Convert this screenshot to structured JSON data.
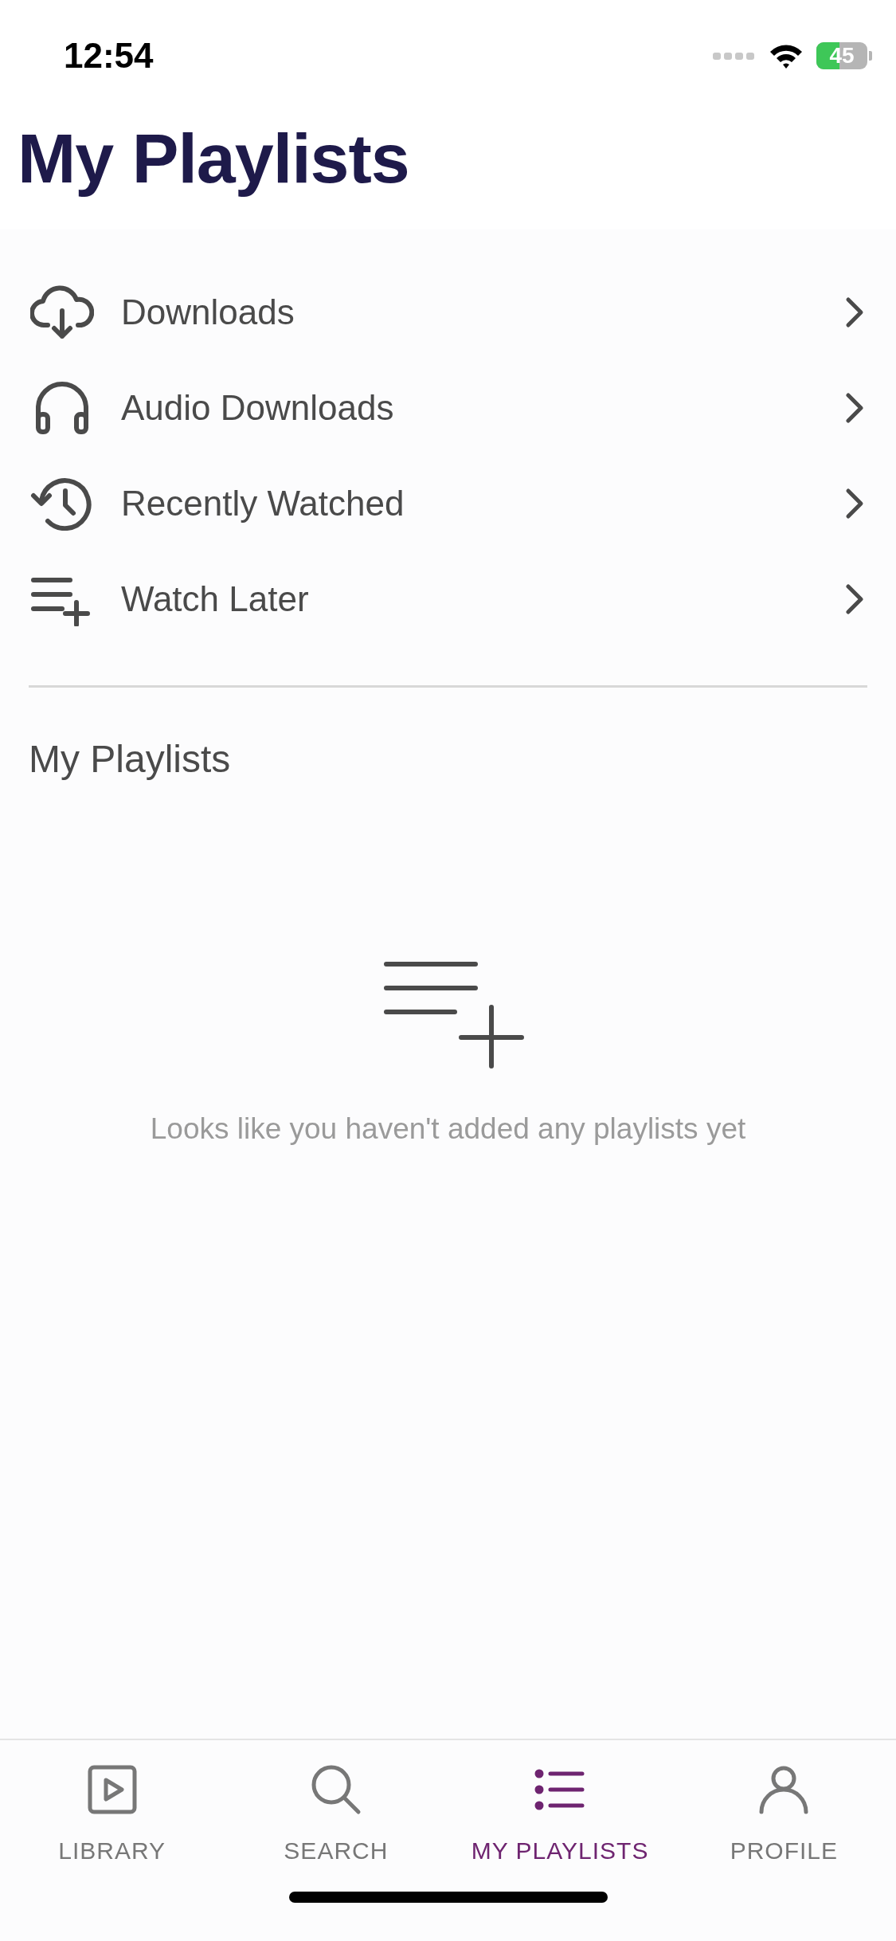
{
  "status_bar": {
    "time": "12:54",
    "battery": "45"
  },
  "title": "My Playlists",
  "menu": [
    {
      "kind": "download",
      "label": "Downloads"
    },
    {
      "kind": "audio",
      "label": "Audio Downloads"
    },
    {
      "kind": "history",
      "label": "Recently Watched"
    },
    {
      "kind": "watch_later",
      "label": "Watch Later"
    }
  ],
  "section": {
    "title": "My Playlists",
    "empty_message": "Looks like you haven't added any playlists yet"
  },
  "tabs": [
    {
      "kind": "library",
      "label": "LIBRARY",
      "selected": false
    },
    {
      "kind": "search",
      "label": "SEARCH",
      "selected": false
    },
    {
      "kind": "playlists",
      "label": "MY PLAYLISTS",
      "selected": true
    },
    {
      "kind": "profile",
      "label": "PROFILE",
      "selected": false
    }
  ]
}
